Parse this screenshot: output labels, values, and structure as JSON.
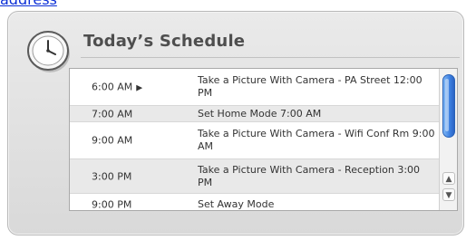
{
  "header": {
    "link_text": "address"
  },
  "widget": {
    "title": "Today’s Schedule"
  },
  "schedule": {
    "rows": [
      {
        "time": "6:00 AM",
        "event": "Take a Picture With Camera - PA Street 12:00 PM",
        "current": true
      },
      {
        "time": "7:00 AM",
        "event": "Set Home Mode 7:00 AM",
        "current": false
      },
      {
        "time": "9:00 AM",
        "event": "Take a Picture With Camera - Wifi Conf Rm 9:00 AM",
        "current": false
      },
      {
        "time": "3:00 PM",
        "event": "Take a Picture With Camera - Reception 3:00 PM",
        "current": false
      },
      {
        "time": "9:00 PM",
        "event": "Set Away Mode",
        "current": false
      }
    ],
    "current_marker": "▶"
  },
  "scroll": {
    "up_glyph": "▲",
    "down_glyph": "▼"
  }
}
